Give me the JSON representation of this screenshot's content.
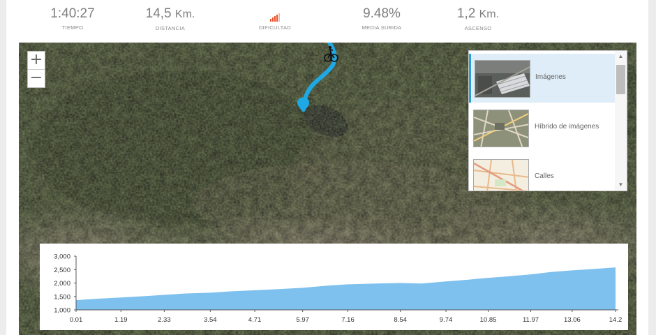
{
  "stats": {
    "time": {
      "value": "1:40:27",
      "label": "TIEMPO"
    },
    "distance": {
      "value": "14,5",
      "unit": "Km.",
      "label": "DISTANCIA"
    },
    "difficulty": {
      "label": "DIFICULTAD",
      "level": 4,
      "max": 5,
      "color": "#e8502a"
    },
    "avg_grade": {
      "value": "9.48%",
      "label": "MEDIA SUBIDA"
    },
    "ascent": {
      "value": "1,2",
      "unit": "Km.",
      "label": "ASCENSO"
    }
  },
  "map": {
    "zoom_in": "+",
    "zoom_out": "−",
    "route_color": "#1ea8e4",
    "icons": [
      "cyclist-marker-icon",
      "start-pin-icon"
    ]
  },
  "basemap_gallery": {
    "items": [
      {
        "label": "Imágenes",
        "selected": true
      },
      {
        "label": "Híbrido de imágenes",
        "selected": false
      },
      {
        "label": "Calles",
        "selected": false
      }
    ],
    "scroll_up": "▲",
    "scroll_down": "▼"
  },
  "chart_data": {
    "type": "area",
    "x_ticks": [
      "0.01",
      "1.19",
      "2.33",
      "3.54",
      "4.71",
      "5.97",
      "7.16",
      "8.54",
      "9.74",
      "10.85",
      "11.97",
      "13.06",
      "14.2"
    ],
    "y_ticks": [
      "1,000",
      "1,500",
      "2,000",
      "2,500",
      "3,000"
    ],
    "ylim": [
      1000,
      3000
    ],
    "xlim": [
      0.01,
      14.2
    ],
    "color": "#7ec0ee",
    "x": [
      0.01,
      0.5,
      1.19,
      1.8,
      2.33,
      2.9,
      3.54,
      4.1,
      4.71,
      5.3,
      5.97,
      6.6,
      7.16,
      7.9,
      8.54,
      9.1,
      9.74,
      10.3,
      10.85,
      11.4,
      11.97,
      12.5,
      13.06,
      13.6,
      14.2
    ],
    "y": [
      1360,
      1410,
      1460,
      1510,
      1560,
      1610,
      1640,
      1690,
      1730,
      1770,
      1820,
      1900,
      1950,
      1980,
      2000,
      1980,
      2060,
      2120,
      2190,
      2250,
      2320,
      2410,
      2470,
      2520,
      2580
    ]
  }
}
